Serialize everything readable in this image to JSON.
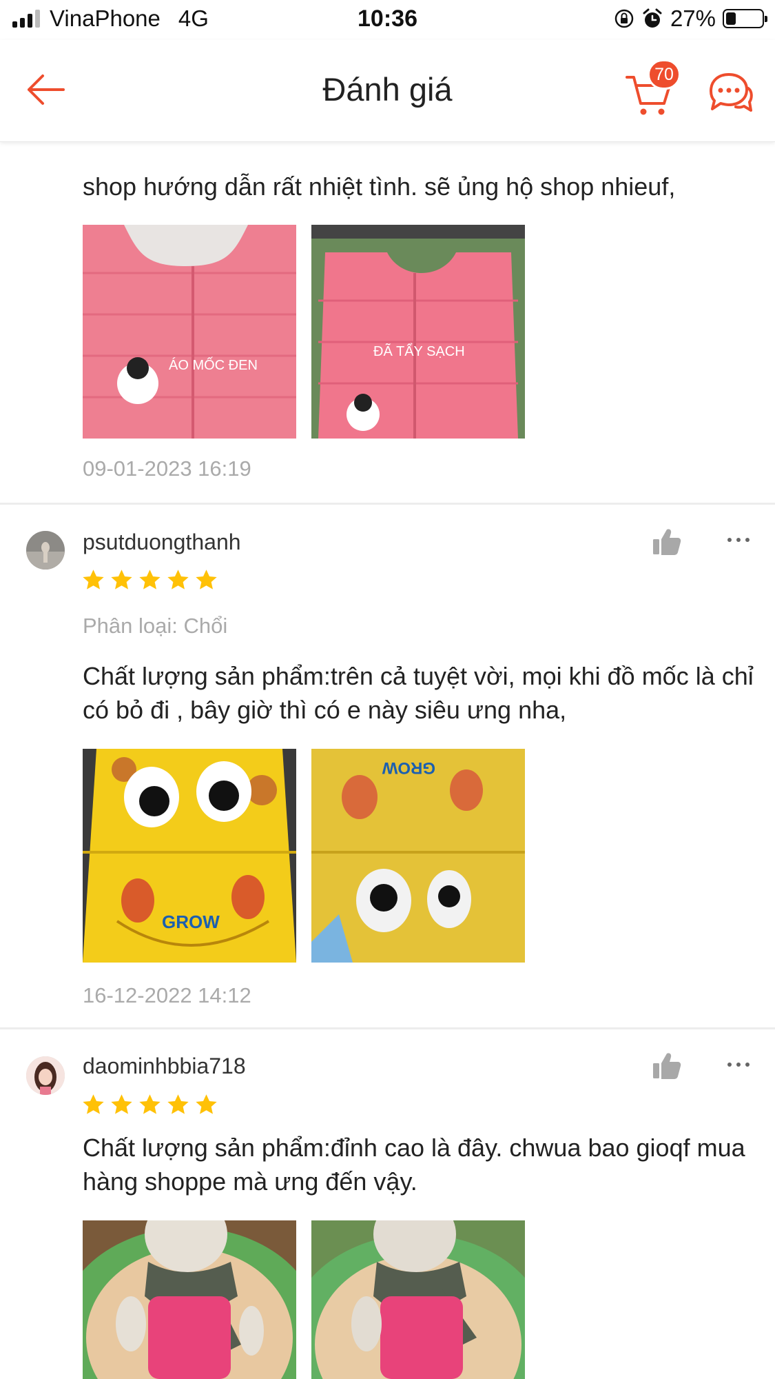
{
  "status_bar": {
    "carrier": "VinaPhone",
    "network": "4G",
    "time": "10:36",
    "battery": "27%",
    "battery_level": 0.27
  },
  "header": {
    "title": "Đánh giá",
    "cart_count": "70",
    "accent_color": "#ee4d2d"
  },
  "reviews": [
    {
      "text": "shop hướng dẫn rất nhiệt tình. sẽ ủng hộ shop nhieuf,",
      "photos": [
        {
          "caption": "ÁO MỐC ĐEN",
          "subject": "pink vest"
        },
        {
          "caption": "ĐÃ TẨY SẠCH",
          "subject": "pink vest"
        }
      ],
      "date": "09-01-2023 16:19"
    },
    {
      "username": "psutduongthanh",
      "rating": 5,
      "variation": "Phân loại: Chổi",
      "text": "Chất lượng sản phẩm:trên cả tuyệt vời, mọi khi đồ mốc là chỉ có bỏ đi , bây giờ thì có e này siêu ưng nha,",
      "photos": [
        {
          "caption": "GROW",
          "subject": "yellow backpack"
        },
        {
          "caption": "GROW",
          "subject": "yellow backpack"
        }
      ],
      "date": "16-12-2022 14:12"
    },
    {
      "username": "daominhbbia718",
      "rating": 5,
      "text": "Chất lượng sản phẩm:đỉnh cao là đây. chwua bao gioqf mua hàng shoppe mà ưng đến vậy.",
      "photos": [
        {
          "subject": "plush bunny"
        },
        {
          "subject": "plush bunny"
        }
      ]
    }
  ],
  "icons": {
    "back": "arrow-left-icon",
    "cart": "cart-icon",
    "chat": "chat-icon",
    "like": "thumbs-up-icon",
    "more": "more-icon",
    "star": "star-icon"
  },
  "colors": {
    "star": "#ffc107",
    "muted_text": "#aaaaaa",
    "like_icon": "#a8a8a8"
  }
}
